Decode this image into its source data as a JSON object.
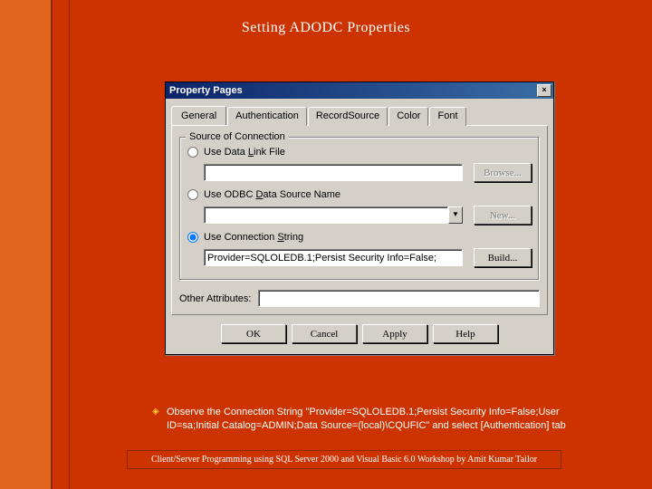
{
  "slide": {
    "title": "Setting ADODC Properties"
  },
  "dialog": {
    "title": "Property Pages",
    "close": "×",
    "tabs": {
      "general": "General",
      "auth": "Authentication",
      "recordsource": "RecordSource",
      "color": "Color",
      "font": "Font"
    },
    "group": {
      "title": "Source of Connection",
      "useDataLink": "Use Data Link File",
      "browse": "Browse...",
      "useOdbc": "Use ODBC Data Source Name",
      "new": "New...",
      "useConnStr": "Use Connection String",
      "connStrValue": "Provider=SQLOLEDB.1;Persist Security Info=False;",
      "build": "Build..."
    },
    "otherAttrib": "Other Attributes:",
    "buttons": {
      "ok": "OK",
      "cancel": "Cancel",
      "apply": "Apply",
      "help": "Help"
    }
  },
  "bullet": {
    "text": "Observe the Connection String \"Provider=SQLOLEDB.1;Persist Security Info=False;User ID=sa;Initial Catalog=ADMIN;Data Source=(local)\\CQUFIC\" and select [Authentication] tab"
  },
  "footer": {
    "text": "Client/Server Programming using SQL Server 2000 and Visual Basic 6.0 Workshop by Amit Kumar Tailor"
  }
}
